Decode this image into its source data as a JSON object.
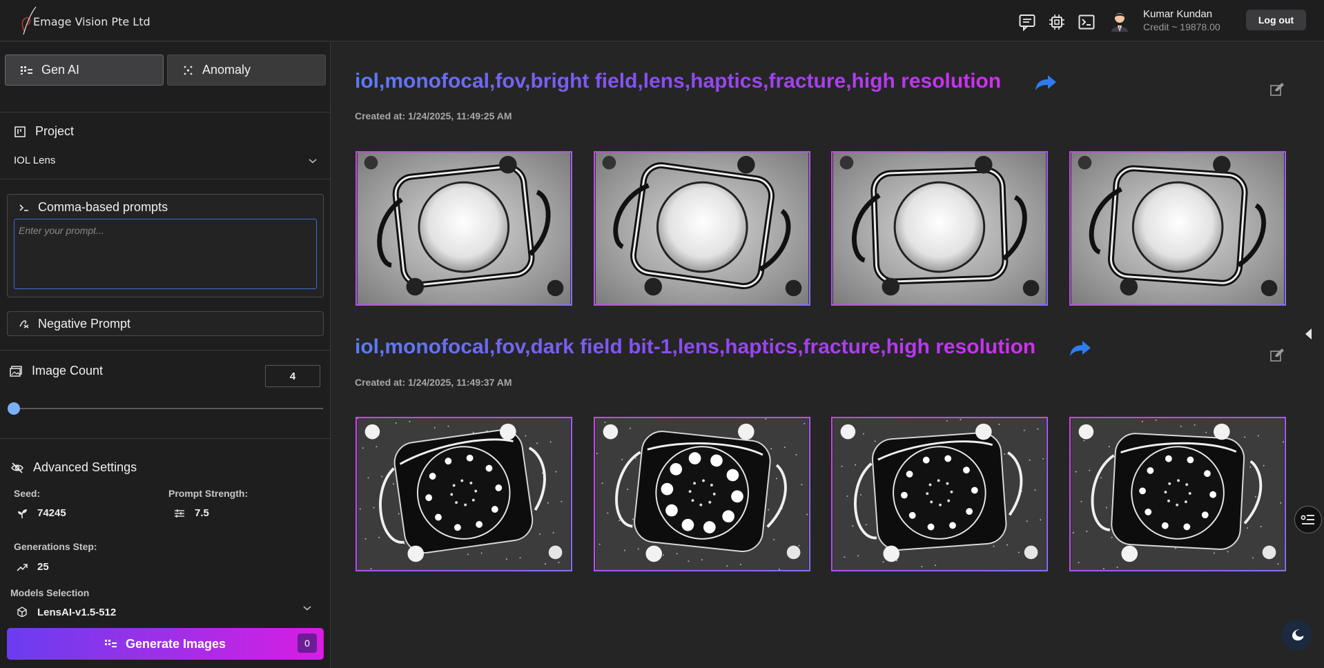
{
  "brand": {
    "name": "Emage Vision Pte Ltd"
  },
  "header": {
    "icons": [
      "chat-icon",
      "chip-icon",
      "terminal-icon"
    ],
    "user_name": "Kumar Kundan",
    "credit": "Credit ~ 19878.00",
    "logout_label": "Log out"
  },
  "sidebar": {
    "tabs": [
      {
        "label": "Gen AI",
        "active": true
      },
      {
        "label": "Anomaly",
        "active": false
      }
    ],
    "project": {
      "title": "Project",
      "selected": "IOL Lens"
    },
    "prompt": {
      "title": "Comma-based prompts",
      "placeholder": "Enter your prompt...",
      "value": ""
    },
    "negative_prompt": {
      "title": "Negative Prompt"
    },
    "image_count": {
      "title": "Image Count",
      "value": "4",
      "fraction": 0.0
    },
    "advanced": {
      "title": "Advanced Settings",
      "seed_label": "Seed:",
      "seed_value": "74245",
      "strength_label": "Prompt Strength:",
      "strength_value": "7.5",
      "steps_label": "Generations Step:",
      "steps_value": "25",
      "models_label": "Models Selection",
      "model_value": "LensAI-v1.5-512"
    },
    "generate": {
      "label": "Generate Images",
      "badge": "0"
    }
  },
  "results": [
    {
      "prompt": "iol,monofocal,fov,bright field,lens,haptics,fracture,high resolution",
      "created": "Created at: 1/24/2025, 11:49:25 AM",
      "style": "bright",
      "image_count": 4
    },
    {
      "prompt": "iol,monofocal,fov,dark field bit-1,lens,haptics,fracture,high resolution",
      "created": "Created at: 1/24/2025, 11:49:37 AM",
      "style": "dark",
      "image_count": 4
    }
  ],
  "colors": {
    "accent_blue": "#3b6fd4",
    "gradient_start": "#5b7cf5",
    "gradient_end": "#d22ef0",
    "share_blue": "#2f7cf0"
  }
}
